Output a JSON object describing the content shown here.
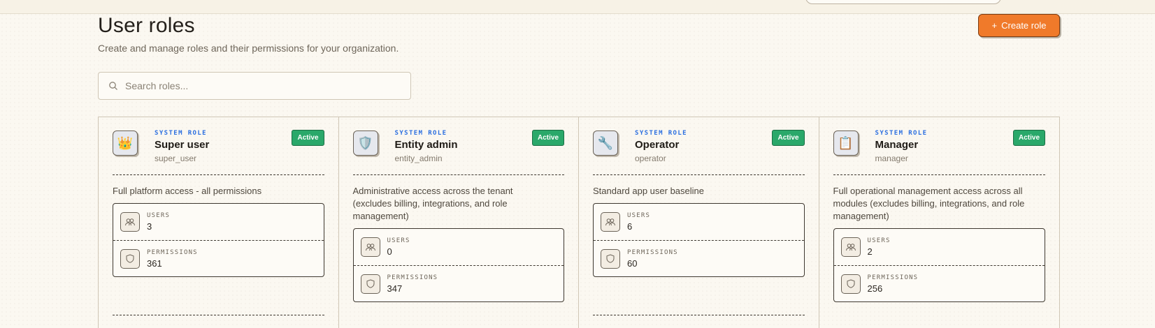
{
  "header": {
    "title": "User roles",
    "subtitle": "Create and manage roles and their permissions for your organization.",
    "create_label": "Create role"
  },
  "search": {
    "placeholder": "Search roles..."
  },
  "labels": {
    "system_role": "SYSTEM ROLE",
    "users": "USERS",
    "permissions": "PERMISSIONS"
  },
  "roles": [
    {
      "name": "Super user",
      "key": "super_user",
      "status": "Active",
      "icon": "crown-icon",
      "glyph": "👑",
      "description": "Full platform access - all permissions",
      "users": "3",
      "permissions": "361"
    },
    {
      "name": "Entity admin",
      "key": "entity_admin",
      "status": "Active",
      "icon": "shield-icon",
      "glyph": "🛡️",
      "description": "Administrative access across the tenant (excludes billing, integrations, and role management)",
      "users": "0",
      "permissions": "347"
    },
    {
      "name": "Operator",
      "key": "operator",
      "status": "Active",
      "icon": "wrench-icon",
      "glyph": "🔧",
      "description": "Standard app user baseline",
      "users": "6",
      "permissions": "60"
    },
    {
      "name": "Manager",
      "key": "manager",
      "status": "Active",
      "icon": "clipboard-icon",
      "glyph": "📋",
      "description": "Full operational management access across all modules (excludes billing, integrations, and role management)",
      "users": "2",
      "permissions": "256"
    }
  ],
  "colors": {
    "accent": "#f07a2a",
    "active": "#2aa86a",
    "system_role": "#2c6fe0"
  }
}
